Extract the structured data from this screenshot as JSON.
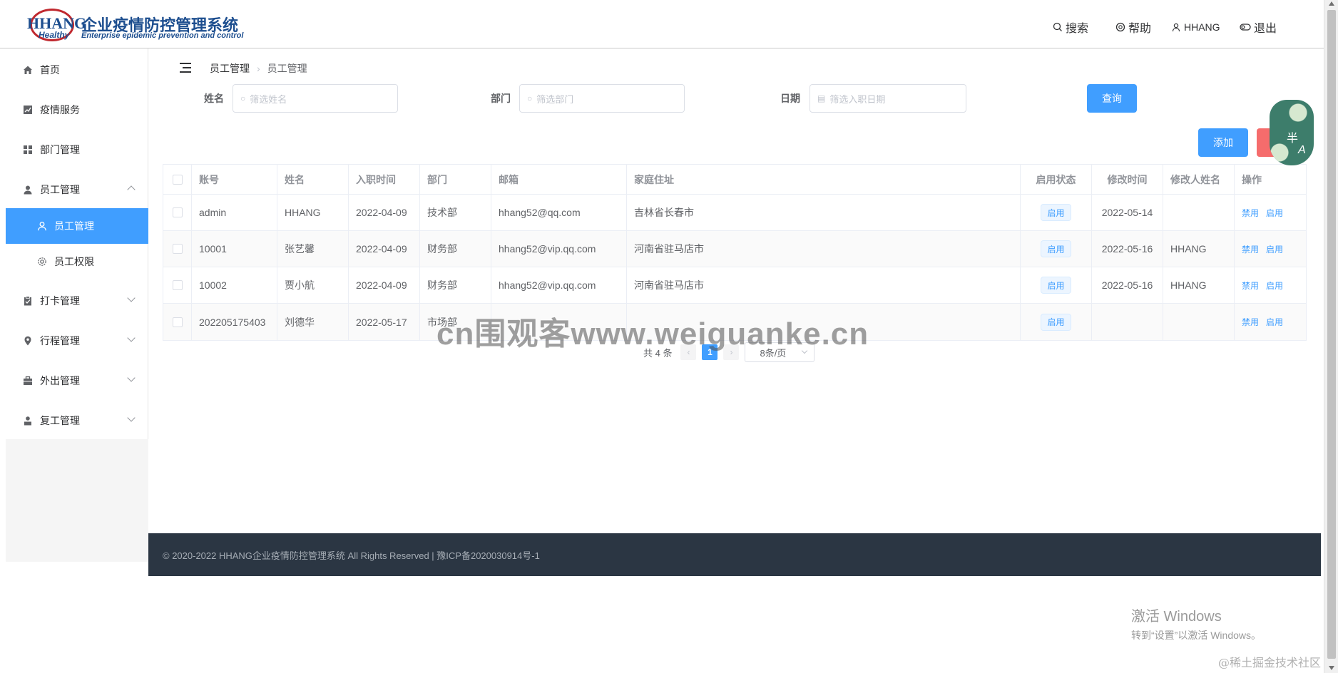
{
  "header": {
    "logo_mark": "HHANG",
    "logo_sub": "Healthy",
    "title_cn": "企业疫情防控管理系统",
    "title_en": "Enterprise epidemic prevention and control",
    "nav": {
      "search": "搜索",
      "help": "帮助",
      "user": "HHANG",
      "logout": "退出"
    }
  },
  "sidebar": {
    "items": [
      {
        "label": "首页",
        "icon": "home-icon"
      },
      {
        "label": "疫情服务",
        "icon": "chart-icon"
      },
      {
        "label": "部门管理",
        "icon": "grid-icon"
      },
      {
        "label": "员工管理",
        "icon": "user-icon",
        "expanded": true
      },
      {
        "label": "员工管理",
        "icon": "user-outline-icon",
        "active": true,
        "sub": true
      },
      {
        "label": "员工权限",
        "icon": "gear-icon",
        "sub": true
      },
      {
        "label": "打卡管理",
        "icon": "clipboard-icon"
      },
      {
        "label": "行程管理",
        "icon": "location-icon"
      },
      {
        "label": "外出管理",
        "icon": "briefcase-icon"
      },
      {
        "label": "复工管理",
        "icon": "worker-icon"
      }
    ]
  },
  "breadcrumb": {
    "parent": "员工管理",
    "current": "员工管理"
  },
  "filters": {
    "name_label": "姓名",
    "name_placeholder": "筛选姓名",
    "dept_label": "部门",
    "dept_placeholder": "筛选部门",
    "date_label": "日期",
    "date_placeholder": "筛选入职日期",
    "query_button": "查询"
  },
  "actions": {
    "add_button": "添加"
  },
  "float_widget": {
    "char1": "半",
    "char2": "A"
  },
  "table": {
    "columns": [
      "账号",
      "姓名",
      "入职时间",
      "部门",
      "邮箱",
      "家庭住址",
      "启用状态",
      "修改时间",
      "修改人姓名",
      "操作"
    ],
    "rows": [
      {
        "account": "admin",
        "name": "HHANG",
        "join_date": "2022-04-09",
        "dept": "技术部",
        "email": "hhang52@qq.com",
        "address": "吉林省长春市",
        "status": "启用",
        "modified": "2022-05-14",
        "modifier": "",
        "op_disable": "禁用",
        "op_enable": "启用"
      },
      {
        "account": "10001",
        "name": "张艺馨",
        "join_date": "2022-04-09",
        "dept": "财务部",
        "email": "hhang52@vip.qq.com",
        "address": "河南省驻马店市",
        "status": "启用",
        "modified": "2022-05-16",
        "modifier": "HHANG",
        "op_disable": "禁用",
        "op_enable": "启用"
      },
      {
        "account": "10002",
        "name": "贾小航",
        "join_date": "2022-04-09",
        "dept": "财务部",
        "email": "hhang52@vip.qq.com",
        "address": "河南省驻马店市",
        "status": "启用",
        "modified": "2022-05-16",
        "modifier": "HHANG",
        "op_disable": "禁用",
        "op_enable": "启用"
      },
      {
        "account": "202205175403",
        "name": "刘德华",
        "join_date": "2022-05-17",
        "dept": "市场部",
        "email": "",
        "address": "",
        "status": "启用",
        "modified": "",
        "modifier": "",
        "op_disable": "禁用",
        "op_enable": "启用"
      }
    ]
  },
  "pagination": {
    "total": "共 4 条",
    "current_page": "1",
    "page_size": "8条/页"
  },
  "watermark": "cn围观客www.weiguanke.cn",
  "footer": {
    "text": "© 2020-2022 HHANG企业疫情防控管理系统 All Rights Reserved | 豫ICP备2020030914号-1"
  },
  "windows": {
    "line1": "激活 Windows",
    "line2": "转到“设置”以激活 Windows。"
  },
  "corner_watermark": "@稀土掘金技术社区",
  "colors": {
    "primary": "#409eff",
    "danger": "#f56c6c",
    "footer_bg": "#2b3643",
    "brand": "#1d4e8f"
  }
}
